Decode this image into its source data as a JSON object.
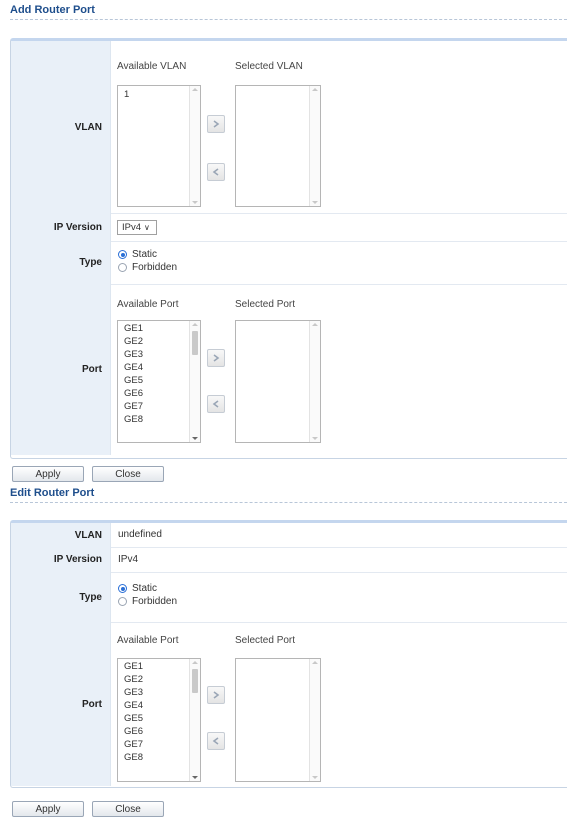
{
  "add": {
    "title": "Add Router Port",
    "vlan": {
      "label": "VLAN",
      "available_caption": "Available VLAN",
      "selected_caption": "Selected VLAN",
      "available_items": [
        "1"
      ],
      "selected_items": []
    },
    "ip_version": {
      "label": "IP Version",
      "value": "IPv4"
    },
    "type": {
      "label": "Type",
      "options": [
        "Static",
        "Forbidden"
      ],
      "selected": "Static"
    },
    "port": {
      "label": "Port",
      "available_caption": "Available Port",
      "selected_caption": "Selected Port",
      "available_items": [
        "GE1",
        "GE2",
        "GE3",
        "GE4",
        "GE5",
        "GE6",
        "GE7",
        "GE8"
      ],
      "selected_items": []
    },
    "buttons": {
      "apply": "Apply",
      "close": "Close"
    }
  },
  "edit": {
    "title": "Edit Router Port",
    "vlan": {
      "label": "VLAN",
      "value": "undefined"
    },
    "ip_version": {
      "label": "IP Version",
      "value": "IPv4"
    },
    "type": {
      "label": "Type",
      "options": [
        "Static",
        "Forbidden"
      ],
      "selected": "Static"
    },
    "port": {
      "label": "Port",
      "available_caption": "Available Port",
      "selected_caption": "Selected Port",
      "available_items": [
        "GE1",
        "GE2",
        "GE3",
        "GE4",
        "GE5",
        "GE6",
        "GE7",
        "GE8"
      ],
      "selected_items": []
    },
    "buttons": {
      "apply": "Apply",
      "close": "Close"
    }
  },
  "icons": {
    "move_right": "chevron-right-icon",
    "move_left": "chevron-left-icon",
    "dropdown": "chevron-down-icon"
  }
}
